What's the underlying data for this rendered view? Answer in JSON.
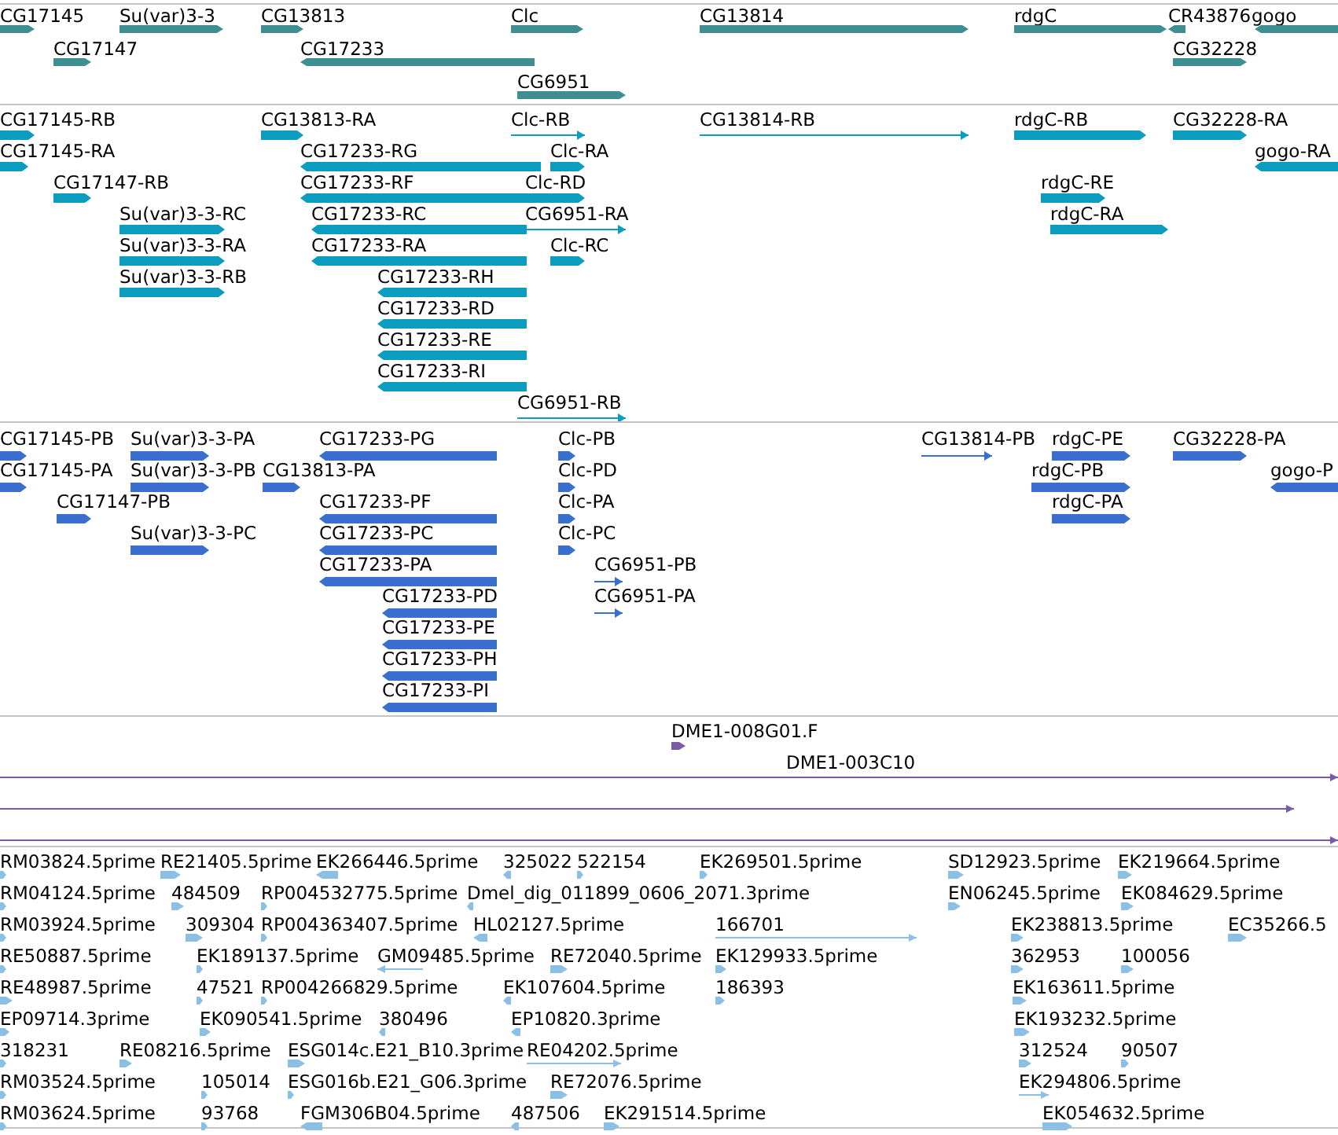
{
  "tracks": [
    {
      "color": "#3f8f92",
      "features": [
        {
          "label": "CG17145",
          "reverse": false
        },
        {
          "label": "Su(var)3-3",
          "reverse": false
        },
        {
          "label": "CG13813",
          "reverse": false
        },
        {
          "label": "Clc",
          "reverse": false
        },
        {
          "label": "CG13814",
          "reverse": false
        },
        {
          "label": "rdgC",
          "reverse": false
        },
        {
          "label": "CR43876",
          "reverse": true
        },
        {
          "label": "gogo",
          "reverse": true
        },
        {
          "label": "CG17147",
          "reverse": false
        },
        {
          "label": "CG17233",
          "reverse": true
        },
        {
          "label": "CG32228",
          "reverse": false
        },
        {
          "label": "CG6951",
          "reverse": false
        }
      ]
    },
    {
      "color": "#0b9cbf",
      "features": [
        {
          "label": "CG17145-RB",
          "reverse": false
        },
        {
          "label": "CG13813-RA",
          "reverse": false
        },
        {
          "label": "Clc-RB",
          "reverse": false
        },
        {
          "label": "CG13814-RB",
          "reverse": false
        },
        {
          "label": "rdgC-RB",
          "reverse": false
        },
        {
          "label": "CG32228-RA",
          "reverse": false
        },
        {
          "label": "CG17145-RA",
          "reverse": false
        },
        {
          "label": "CG17233-RG",
          "reverse": true
        },
        {
          "label": "Clc-RA",
          "reverse": false
        },
        {
          "label": "gogo-RA",
          "reverse": true
        },
        {
          "label": "CG17147-RB",
          "reverse": false
        },
        {
          "label": "CG17233-RF",
          "reverse": true
        },
        {
          "label": "Clc-RD",
          "reverse": false
        },
        {
          "label": "rdgC-RE",
          "reverse": false
        },
        {
          "label": "Su(var)3-3-RC",
          "reverse": false
        },
        {
          "label": "CG17233-RC",
          "reverse": true
        },
        {
          "label": "CG6951-RA",
          "reverse": false
        },
        {
          "label": "rdgC-RA",
          "reverse": false
        },
        {
          "label": "Su(var)3-3-RA",
          "reverse": false
        },
        {
          "label": "CG17233-RA",
          "reverse": true
        },
        {
          "label": "Clc-RC",
          "reverse": false
        },
        {
          "label": "Su(var)3-3-RB",
          "reverse": false
        },
        {
          "label": "CG17233-RH",
          "reverse": true
        },
        {
          "label": "CG17233-RD",
          "reverse": true
        },
        {
          "label": "CG17233-RE",
          "reverse": true
        },
        {
          "label": "CG17233-RI",
          "reverse": true
        },
        {
          "label": "CG6951-RB",
          "reverse": false
        }
      ]
    },
    {
      "color": "#3a6fd0",
      "features": [
        {
          "label": "CG17145-PB",
          "reverse": false
        },
        {
          "label": "Su(var)3-3-PA",
          "reverse": false
        },
        {
          "label": "CG17233-PG",
          "reverse": true
        },
        {
          "label": "Clc-PB",
          "reverse": false
        },
        {
          "label": "CG13814-PB",
          "reverse": false
        },
        {
          "label": "rdgC-PE",
          "reverse": false
        },
        {
          "label": "CG32228-PA",
          "reverse": false
        },
        {
          "label": "CG17145-PA",
          "reverse": false
        },
        {
          "label": "Su(var)3-3-PB",
          "reverse": false
        },
        {
          "label": "CG13813-PA",
          "reverse": false
        },
        {
          "label": "Clc-PD",
          "reverse": false
        },
        {
          "label": "rdgC-PB",
          "reverse": false
        },
        {
          "label": "gogo-P",
          "reverse": true
        },
        {
          "label": "CG17147-PB",
          "reverse": false
        },
        {
          "label": "CG17233-PF",
          "reverse": true
        },
        {
          "label": "Clc-PA",
          "reverse": false
        },
        {
          "label": "rdgC-PA",
          "reverse": false
        },
        {
          "label": "Su(var)3-3-PC",
          "reverse": false
        },
        {
          "label": "CG17233-PC",
          "reverse": true
        },
        {
          "label": "Clc-PC",
          "reverse": false
        },
        {
          "label": "CG17233-PA",
          "reverse": true
        },
        {
          "label": "CG6951-PB",
          "reverse": false
        },
        {
          "label": "CG17233-PD",
          "reverse": true
        },
        {
          "label": "CG6951-PA",
          "reverse": false
        },
        {
          "label": "CG17233-PE",
          "reverse": true
        },
        {
          "label": "CG17233-PH",
          "reverse": true
        },
        {
          "label": "CG17233-PI",
          "reverse": true
        }
      ]
    },
    {
      "color": "#7b5aa6",
      "features": [
        {
          "label": "DME1-008G01.F",
          "reverse": false
        },
        {
          "label": "DME1-003C10",
          "reverse": false
        },
        {
          "reverse": false
        },
        {
          "reverse": false
        }
      ]
    },
    {
      "color": "#8bbfe3",
      "features": [
        {
          "label": "RM03824.5prime",
          "reverse": false
        },
        {
          "label": "RE21405.5prime",
          "reverse": false
        },
        {
          "label": "EK266446.5prime",
          "reverse": true
        },
        {
          "label": "325022",
          "reverse": true
        },
        {
          "label": "522154",
          "reverse": false
        },
        {
          "label": "EK269501.5prime",
          "reverse": false
        },
        {
          "label": "SD12923.5prime",
          "reverse": false
        },
        {
          "label": "EK219664.5prime",
          "reverse": false
        },
        {
          "label": "RM04124.5prime",
          "reverse": false
        },
        {
          "label": "484509",
          "reverse": false
        },
        {
          "label": "RP004532775.5prime",
          "reverse": false
        },
        {
          "label": "Dmel_dig_011899_0606_2071.3prime",
          "reverse": true
        },
        {
          "label": "EN06245.5prime",
          "reverse": false
        },
        {
          "label": "EK084629.5prime",
          "reverse": false
        },
        {
          "label": "RM03924.5prime",
          "reverse": false
        },
        {
          "label": "309304",
          "reverse": false
        },
        {
          "label": "RP004363407.5prime",
          "reverse": false
        },
        {
          "label": "HL02127.5prime",
          "reverse": true
        },
        {
          "label": "166701",
          "reverse": false
        },
        {
          "label": "EK238813.5prime",
          "reverse": false
        },
        {
          "label": "EC35266.5",
          "reverse": false
        },
        {
          "label": "RE50887.5prime",
          "reverse": false
        },
        {
          "label": "EK189137.5prime",
          "reverse": false
        },
        {
          "label": "GM09485.5prime",
          "reverse": true
        },
        {
          "label": "RE72040.5prime",
          "reverse": false
        },
        {
          "label": "EK129933.5prime",
          "reverse": false
        },
        {
          "label": "362953",
          "reverse": false
        },
        {
          "label": "100056",
          "reverse": false
        },
        {
          "label": "RE48987.5prime",
          "reverse": false
        },
        {
          "label": "47521",
          "reverse": false
        },
        {
          "label": "RP004266829.5prime",
          "reverse": false
        },
        {
          "label": "EK107604.5prime",
          "reverse": true
        },
        {
          "label": "186393",
          "reverse": false
        },
        {
          "label": "EK163611.5prime",
          "reverse": false
        },
        {
          "label": "EP09714.3prime",
          "reverse": false
        },
        {
          "label": "EK090541.5prime",
          "reverse": false
        },
        {
          "label": "380496",
          "reverse": true
        },
        {
          "label": "EP10820.3prime",
          "reverse": true
        },
        {
          "label": "EK193232.5prime",
          "reverse": false
        },
        {
          "label": "318231",
          "reverse": false
        },
        {
          "label": "RE08216.5prime",
          "reverse": false
        },
        {
          "label": "ESG014c.E21_B10.3prime",
          "reverse": false
        },
        {
          "label": "RE04202.5prime",
          "reverse": false
        },
        {
          "label": "312524",
          "reverse": false
        },
        {
          "label": "90507",
          "reverse": false
        },
        {
          "label": "RM03524.5prime",
          "reverse": false
        },
        {
          "label": "105014",
          "reverse": false
        },
        {
          "label": "ESG016b.E21_G06.3prime",
          "reverse": false
        },
        {
          "label": "RE72076.5prime",
          "reverse": false
        },
        {
          "label": "EK294806.5prime",
          "reverse": false
        },
        {
          "label": "RM03624.5prime",
          "reverse": false
        },
        {
          "label": "93768",
          "reverse": false
        },
        {
          "label": "FGM306B04.5prime",
          "reverse": true
        },
        {
          "label": "487506",
          "reverse": true
        },
        {
          "label": "EK291514.5prime",
          "reverse": false
        },
        {
          "label": "EK054632.5prime",
          "reverse": false
        }
      ]
    }
  ]
}
